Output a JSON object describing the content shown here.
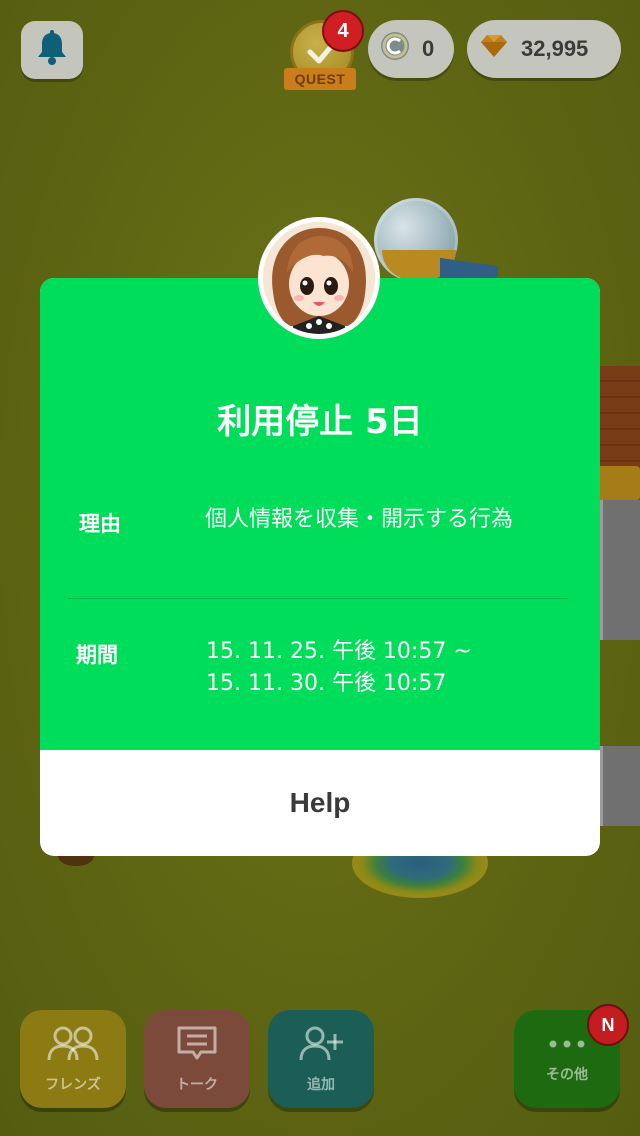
{
  "hud": {
    "quest_badge_count": "4",
    "quest_label": "QUEST",
    "coin_count": "0",
    "gem_count": "32,995",
    "icons": {
      "notifications": "bell-icon",
      "quest": "checkmark-icon",
      "coin": "coin-icon",
      "gem": "gem-icon"
    }
  },
  "modal": {
    "title": "利用停止 5日",
    "reason_label": "理由",
    "reason_value": "個人情報を収集・開示する行為",
    "period_label": "期間",
    "period_start": "15. 11. 25. 午後 10:57 ~",
    "period_end": "15. 11. 30. 午後 10:57",
    "help_label": "Help",
    "accent_color": "#00dd5a"
  },
  "bottom_nav": {
    "friends_label": "フレンズ",
    "talk_label": "トーク",
    "add_label": "追加",
    "other_label": "その他",
    "other_badge": "N",
    "icons": {
      "friends": "friends-icon",
      "talk": "chat-icon",
      "add": "add-friend-icon",
      "other": "more-dots-icon"
    }
  }
}
